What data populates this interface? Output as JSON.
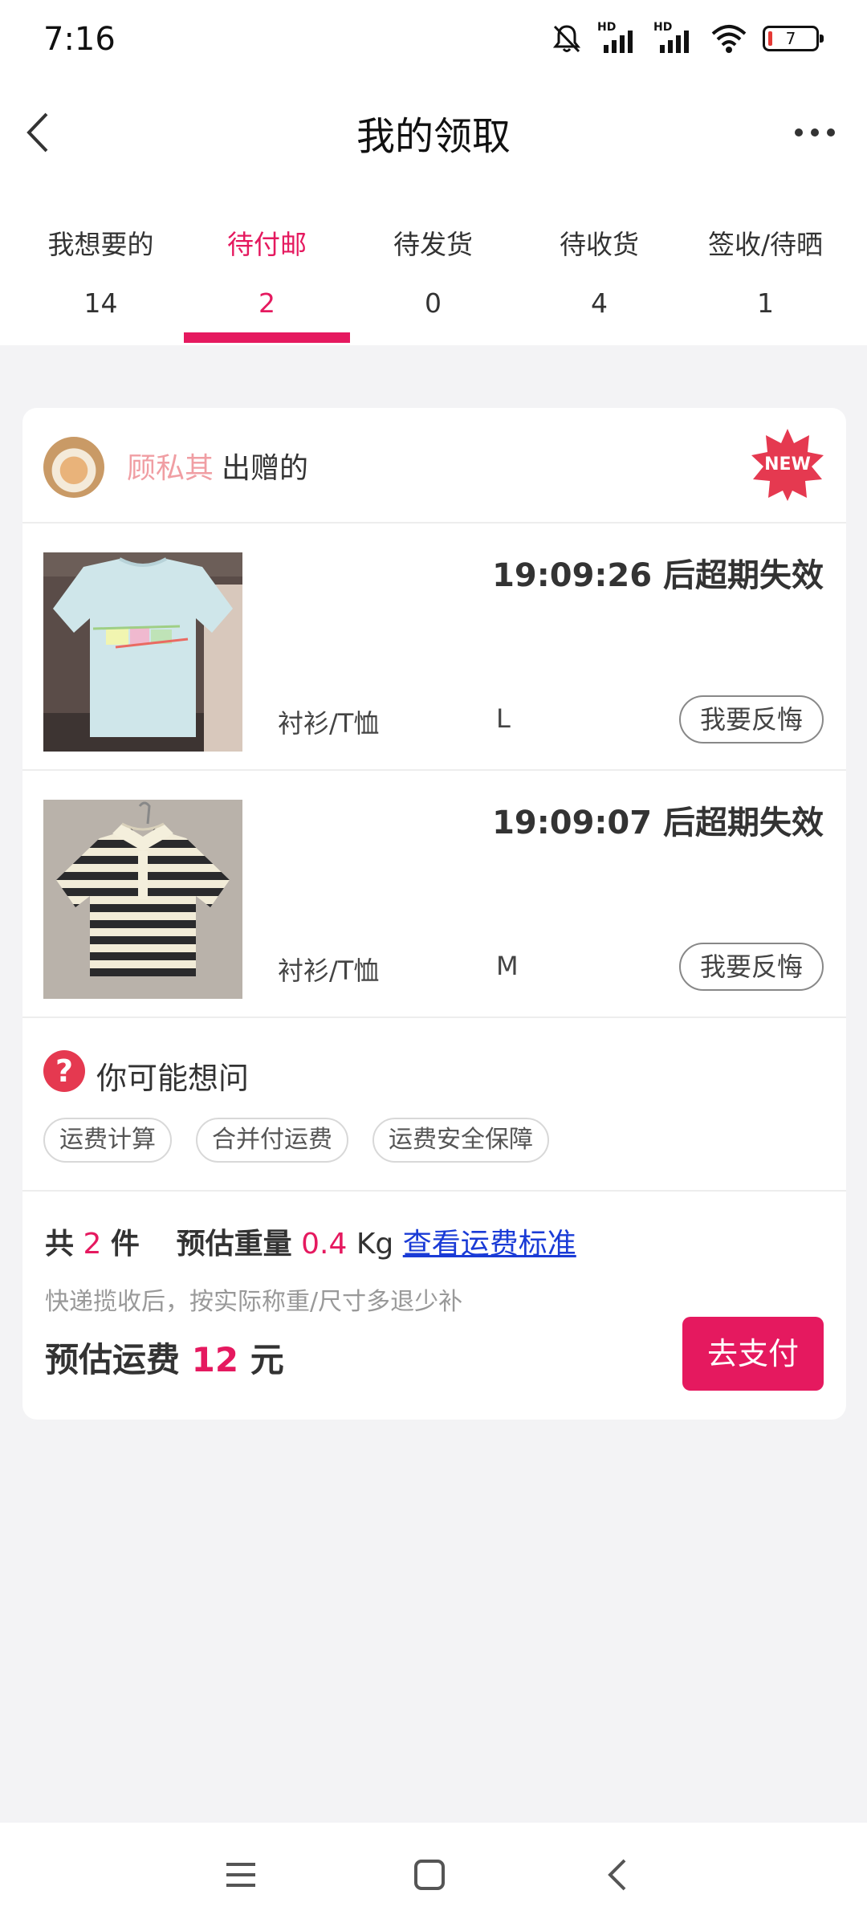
{
  "status_bar": {
    "time": "7:16",
    "network_1": "HD",
    "network_2": "HD",
    "battery_level": "7",
    "icons": [
      "mute-bell-icon",
      "signal-icon",
      "signal-icon",
      "wifi-icon",
      "battery-icon"
    ]
  },
  "header": {
    "title": "我的领取",
    "back_icon": "chevron-left-icon",
    "more_icon": "more-dots-icon"
  },
  "tabs": [
    {
      "label": "我想要的",
      "count": "14",
      "active": false
    },
    {
      "label": "待付邮",
      "count": "2",
      "active": true
    },
    {
      "label": "待发货",
      "count": "0",
      "active": false
    },
    {
      "label": "待收货",
      "count": "4",
      "active": false
    },
    {
      "label": "签收/待晒",
      "count": "1",
      "active": false
    }
  ],
  "card": {
    "donor": {
      "name": "顾私其",
      "suffix": "出赠的",
      "badge": "NEW"
    },
    "items": [
      {
        "countdown": "19:09:26 后超期失效",
        "category": "衬衫/T恤",
        "size": "L",
        "action": "我要反悔"
      },
      {
        "countdown": "19:09:07 后超期失效",
        "category": "衬衫/T恤",
        "size": "M",
        "action": "我要反悔"
      }
    ],
    "faq": {
      "title": "你可能想问",
      "icon": "question-icon",
      "chips": [
        "运费计算",
        "合并付运费",
        "运费安全保障"
      ]
    },
    "summary": {
      "total_prefix": "共",
      "total_count": "2",
      "total_unit": "件",
      "weight_label": "预估重量",
      "weight_value": "0.4",
      "weight_unit": "Kg",
      "shipping_link": "查看运费标准",
      "hint": "快递揽收后，按实际称重/尺寸多退少补",
      "fee_label": "预估运费",
      "fee_value": "12",
      "fee_unit": "元",
      "pay_button": "去支付"
    }
  },
  "colors": {
    "accent": "#e5195f",
    "donor_name": "#f09ea3",
    "link": "#1a3bd6"
  },
  "nav_bar": {
    "icons": [
      "menu-icon",
      "home-square-icon",
      "back-icon"
    ]
  }
}
